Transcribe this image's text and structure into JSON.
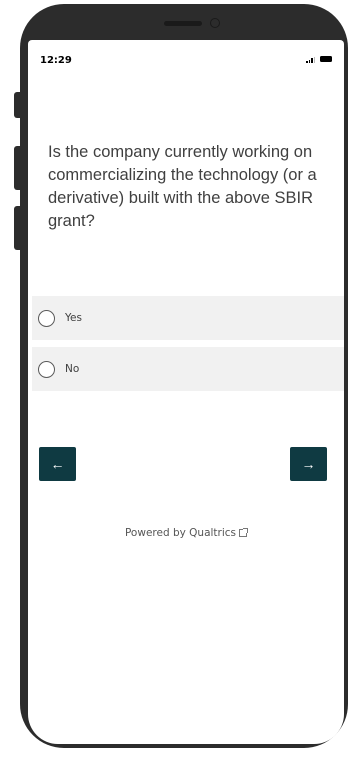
{
  "status_bar": {
    "time": "12:29"
  },
  "survey": {
    "question": "Is the company currently working on commercializing the technology (or a derivative) built with the above SBIR grant?",
    "choices": [
      {
        "label": "Yes",
        "selected": false
      },
      {
        "label": "No",
        "selected": false
      }
    ]
  },
  "navigation": {
    "back_label": "←",
    "next_label": "→"
  },
  "footer": {
    "powered_by": "Powered by Qualtrics"
  },
  "colors": {
    "button_bg": "#0f3a42",
    "choice_bg": "#f1f1f1",
    "frame": "#2c2c2c"
  },
  "icons": {
    "status_signal": "signal-icon",
    "status_battery": "battery-icon",
    "radio": "radio-circle-icon",
    "external_link": "external-link-icon"
  }
}
